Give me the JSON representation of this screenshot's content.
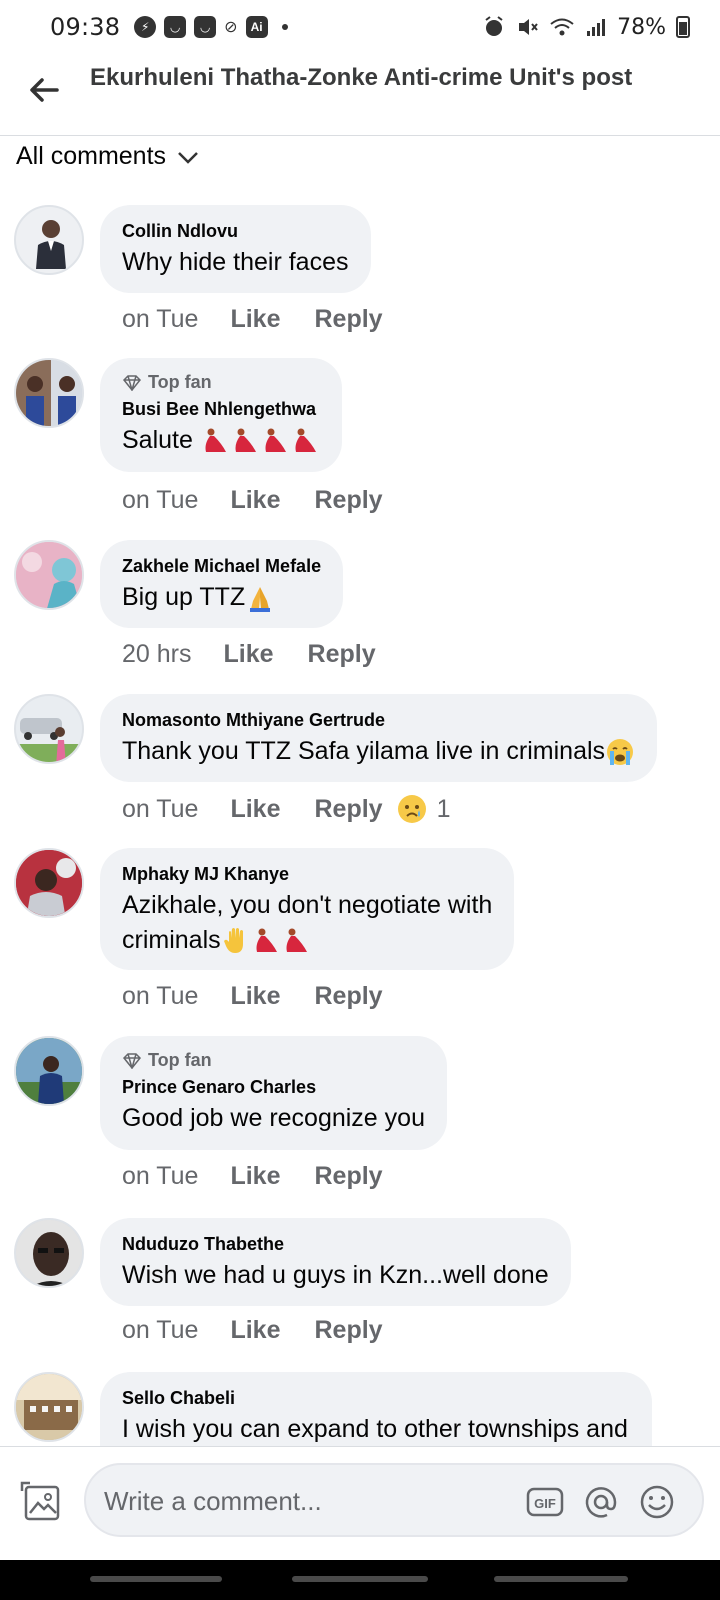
{
  "status_bar": {
    "time": "09:38",
    "battery": "78%",
    "left_icons": [
      "messenger-icon",
      "app-icon",
      "app-icon",
      "mute-icon",
      "ai-icon",
      "dot-icon"
    ],
    "right_icons": [
      "alarm-icon",
      "vibrate-off-icon",
      "wifi-icon",
      "signal-icon",
      "battery-icon"
    ]
  },
  "header": {
    "title": "Ekurhuleni Thatha-Zonke Anti-crime Unit's post",
    "back_icon": "back-arrow-icon"
  },
  "filter": {
    "label": "All comments",
    "icon": "chevron-down-icon"
  },
  "labels": {
    "like": "Like",
    "reply": "Reply",
    "top_fan": "Top fan"
  },
  "comments": [
    {
      "author": "Collin Ndlovu",
      "text": "Why hide their faces",
      "time": "on Tue",
      "top_fan": false
    },
    {
      "author": "Busi Bee Nhlengethwa",
      "text": "Salute",
      "emoji_tail": [
        "dancer-emoji",
        "dancer-emoji",
        "dancer-emoji",
        "dancer-emoji"
      ],
      "time": "on Tue",
      "top_fan": true
    },
    {
      "author": "Zakhele Michael Mefale",
      "text": "Big up TTZ",
      "emoji_tail": [
        "folded-hands-emoji"
      ],
      "time": "20 hrs",
      "top_fan": false
    },
    {
      "author": "Nomasonto Mthiyane Gertrude",
      "text": "Thank you TTZ Safa yilama live in criminals",
      "emoji_tail": [
        "crying-emoji"
      ],
      "time": "on Tue",
      "top_fan": false,
      "reaction": {
        "emoji": "sad-emoji",
        "count": "1"
      }
    },
    {
      "author": "Mphaky MJ Khanye",
      "text_line1": "Azikhale, you don't negotiate with",
      "text_line2": "criminals",
      "emoji_tail": [
        "raised-hand-emoji",
        "dancer-emoji",
        "dancer-emoji"
      ],
      "time": "on Tue",
      "top_fan": false
    },
    {
      "author": "Prince Genaro Charles",
      "text": "Good job we recognize you",
      "time": "on Tue",
      "top_fan": true
    },
    {
      "author": "Nduduzo Thabethe",
      "text": "Wish we had u guys in Kzn...well done",
      "time": "on Tue",
      "top_fan": false
    },
    {
      "author": "Sello Chabeli",
      "text": "I wish you can expand to other townships and",
      "top_fan": false
    }
  ],
  "composer": {
    "placeholder": "Write a comment...",
    "gif_label": "GIF",
    "icons": [
      "photo-icon",
      "gif-icon",
      "mention-icon",
      "emoji-icon"
    ]
  },
  "colors": {
    "bubble": "#f0f2f5",
    "meta_text": "#65676b",
    "primary_text": "#050505",
    "dancer_red": "#d7263d"
  }
}
